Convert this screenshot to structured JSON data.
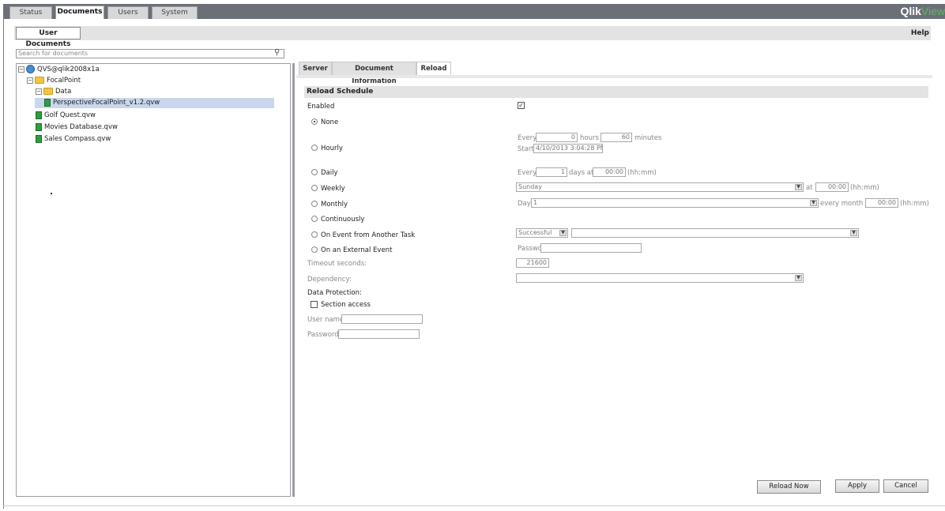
{
  "top_tabs": [
    "Status",
    "Documents",
    "Users",
    "System"
  ],
  "logo": {
    "qlik": "Qlik",
    "view": "View"
  },
  "subbar": {
    "user_documents": "User Documents",
    "help": "Help"
  },
  "search": {
    "placeholder": "Search for documents"
  },
  "tree": {
    "server": "QVS@qlik2008x1a",
    "folder": "FocalPoint",
    "subfolder": "Data",
    "selected_doc": "PerspectiveFocalPoint_v1.2.qvw",
    "docs": [
      "Golf Quest.qvw",
      "Movies Database.qvw",
      "Sales Compass.qvw"
    ]
  },
  "right_tabs": [
    "Server",
    "Document Information",
    "Reload"
  ],
  "reload": {
    "section_title": "Reload Schedule",
    "enabled_label": "Enabled",
    "enabled_checked": "☑",
    "options": {
      "none": "None",
      "hourly": "Hourly",
      "daily": "Daily",
      "weekly": "Weekly",
      "monthly": "Monthly",
      "continuously": "Continuously",
      "on_event_task": "On Event from Another Task",
      "on_external": "On an External Event"
    },
    "hourly": {
      "every": "Every",
      "hours_value": "0",
      "hours_and": "hours and",
      "minutes_value": "60",
      "minutes": "minutes",
      "start": "Start",
      "start_value": "4/10/2013 3:04:28 PM"
    },
    "daily": {
      "every": "Every",
      "days_value": "1",
      "days_at": "days at",
      "time_value": "00:00",
      "hhmm": "(hh:mm)"
    },
    "weekly": {
      "day_value": "Sunday",
      "at": "at",
      "time_value": "00:00",
      "hhmm": "(hh:mm)"
    },
    "monthly": {
      "day": "Day",
      "day_value": "1",
      "every_month_at": "every month at",
      "time_value": "00:00",
      "hhmm": "(hh:mm)"
    },
    "event_task": {
      "status_value": "Successful",
      "task_value": ""
    },
    "external": {
      "password_label": "Password:"
    },
    "timeout_label": "Timeout seconds:",
    "timeout_value": "21600",
    "dependency_label": "Dependency:",
    "data_protection_label": "Data Protection:",
    "section_access_label": "Section access",
    "user_name_label": "User name:",
    "password_label": "Password:"
  },
  "buttons": {
    "reload_now": "Reload Now",
    "apply": "Apply",
    "cancel": "Cancel"
  }
}
